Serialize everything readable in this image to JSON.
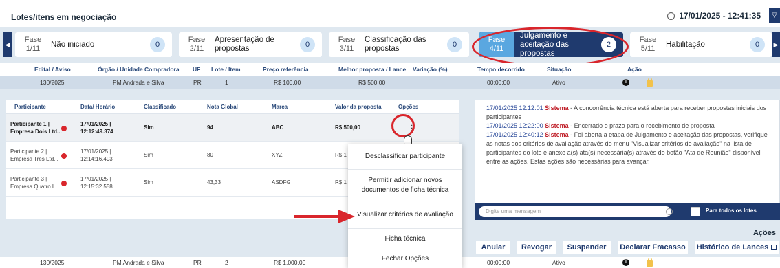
{
  "header": {
    "title": "Lotes/itens em negociação",
    "datetime": "17/01/2025 - 12:41:35",
    "filter_icon": "filter-icon"
  },
  "phases": [
    {
      "label": "Fase",
      "number": "1/11",
      "name": "Não iniciado",
      "count": "0"
    },
    {
      "label": "Fase",
      "number": "2/11",
      "name": "Apresentação de propostas",
      "count": "0"
    },
    {
      "label": "Fase",
      "number": "3/11",
      "name": "Classificação das propostas",
      "count": "0"
    },
    {
      "label": "Fase",
      "number": "4/11",
      "name": "Julgamento e aceitação das propostas",
      "count": "2",
      "active": true
    },
    {
      "label": "Fase",
      "number": "5/11",
      "name": "Habilitação",
      "count": "0"
    }
  ],
  "lots": {
    "columns": [
      "Edital / Aviso",
      "Órgão / Unidade Compradora",
      "UF",
      "Lote / Item",
      "Preço referência",
      "Melhor proposta / Lance",
      "Variação (%)",
      "Tempo decorrido",
      "Situação",
      "Ação"
    ],
    "rows": [
      {
        "edital": "130/2025",
        "orgao": "PM Andrada e Silva",
        "uf": "PR",
        "lote": "1",
        "preco": "R$ 100,00",
        "melhor": "R$ 500,00",
        "variacao": "",
        "tempo": "00:00:00",
        "situacao": "Ativo"
      },
      {
        "edital": "130/2025",
        "orgao": "PM Andrada e Silva",
        "uf": "PR",
        "lote": "2",
        "preco": "R$ 1.000,00",
        "melhor": "",
        "variacao": "",
        "tempo": "00:00:00",
        "situacao": "Ativo"
      }
    ]
  },
  "participants": {
    "columns": [
      "Participante",
      "Data/ Horário",
      "Classificado",
      "Nota Global",
      "Marca",
      "Valor da proposta",
      "Opções"
    ],
    "rows": [
      {
        "name": "Participante 1 | Empresa Dois Ltd...",
        "date": "17/01/2025 |",
        "time": "12:12:49.374",
        "classificado": "Sim",
        "nota": "94",
        "marca": "ABC",
        "valor": "R$ 500,00",
        "opcoes": "⋮"
      },
      {
        "name": "Participante 2 | Empresa Três Ltd...",
        "date": "17/01/2025 |",
        "time": "12:14:16.493",
        "classificado": "Sim",
        "nota": "80",
        "marca": "XYZ",
        "valor": "R$ 1",
        "opcoes": ""
      },
      {
        "name": "Participante 3 | Empresa Quatro L...",
        "date": "17/01/2025 |",
        "time": "12:15:32.558",
        "classificado": "Sim",
        "nota": "43,33",
        "marca": "ASDFG",
        "valor": "R$ 1",
        "opcoes": ""
      }
    ]
  },
  "menu": {
    "items": [
      "Desclassificar participante",
      "Permitir adicionar novos documentos de ficha técnica",
      "Visualizar critérios de avaliação",
      "Ficha técnica",
      "Fechar Opções"
    ]
  },
  "chat": {
    "messages": [
      {
        "ts": "17/01/2025 12:12:01",
        "sender": "Sistema",
        "text": " - A concorrência técnica está aberta para receber propostas iniciais dos participantes"
      },
      {
        "ts": "17/01/2025 12:22:00",
        "sender": "Sistema",
        "text": " - Encerrado o prazo para o recebimento de proposta"
      },
      {
        "ts": "17/01/2025 12:40:12",
        "sender": "Sistema",
        "text": " - Foi aberta a etapa de Julgamento e aceitação das propostas, verifique as notas dos critérios de avaliação através do menu \"Visualizar critérios de avaliação\" na lista de participantes do lote e anexe a(s) ata(s) necessária(s) através do botão \"Ata de Reunião\" disponível entre as ações. Estas ações são necessárias para avançar."
      }
    ],
    "placeholder": "Digite uma mensagem",
    "all_lots_label": "Para todos os lotes"
  },
  "actions": {
    "title": "Ações",
    "buttons": [
      "Anular",
      "Revogar",
      "Suspender",
      "Declarar Fracasso",
      "Histórico de Lances"
    ]
  },
  "colors": {
    "primary": "#1f3a6e",
    "accent": "#5aa7e0",
    "highlight": "#d9262c",
    "system": "#c0202a"
  }
}
